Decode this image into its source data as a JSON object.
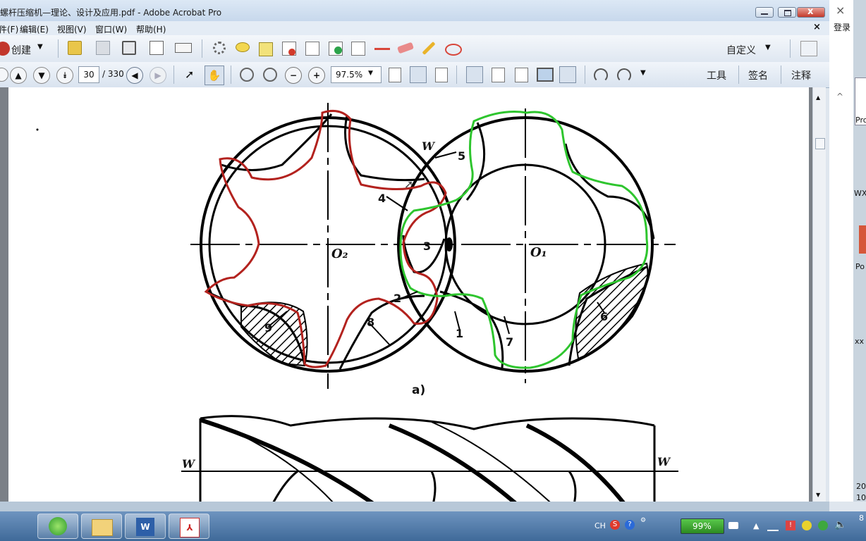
{
  "window": {
    "title": "螺杆压缩机—理论、设计及应用.pdf - Adobe Acrobat Pro",
    "close_glyph": "x"
  },
  "menu": [
    "文件(F)",
    "编辑(E)",
    "视图(V)",
    "窗口(W)",
    "帮助(H)"
  ],
  "toolbar1": {
    "create_label": "创建",
    "customize_label": "自定义"
  },
  "toolbar2": {
    "page_current": "30",
    "page_total": "/ 330",
    "zoom": "97.5%",
    "tools_label": "工具",
    "sign_label": "签名",
    "comment_label": "注释"
  },
  "right_panel": {
    "login": "登录",
    "items": [
      "Pro",
      "WX",
      "Po",
      "xx"
    ],
    "date_fragment": [
      "20",
      "10"
    ],
    "close_glyph": "×",
    "collapse_glyph": "^"
  },
  "figure": {
    "caption": "a)",
    "labels": {
      "o2": "O₂",
      "o1": "O₁",
      "w": "W",
      "n1": "1",
      "n2": "2",
      "n3": "3",
      "n4": "4",
      "n5": "5",
      "n6": "6",
      "n7": "7",
      "n8": "8",
      "n9": "9"
    }
  },
  "tray": {
    "ime": "CH",
    "battery": "99%",
    "clock_fragment": "8"
  },
  "colors": {
    "red_outline": "#b3221e",
    "green_outline": "#2ec52e"
  }
}
